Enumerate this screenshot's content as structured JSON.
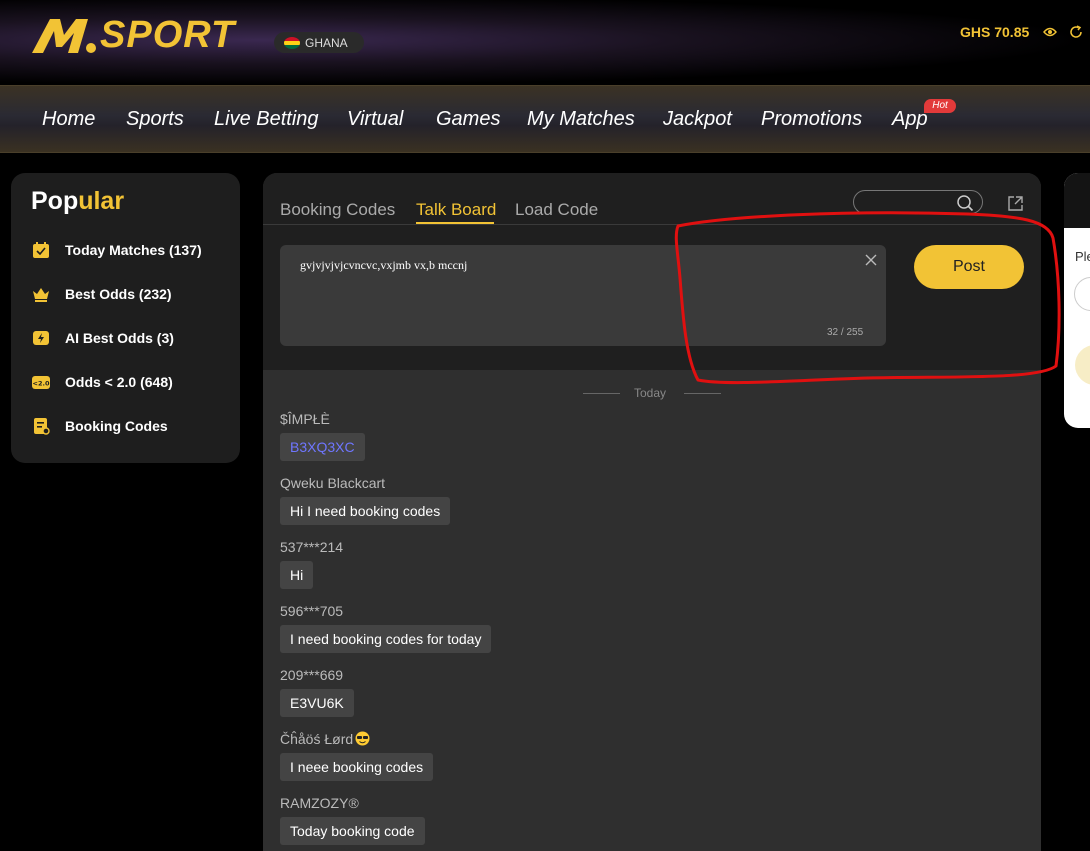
{
  "header": {
    "logo_text": "SPORT",
    "country": "GHANA",
    "balance": "GHS 70.85",
    "icons": [
      "m-logo-icon",
      "ghana-flag-icon",
      "eye-icon",
      "refresh-icon"
    ]
  },
  "nav": {
    "items": [
      "Home",
      "Sports",
      "Live Betting",
      "Virtual",
      "Games",
      "My Matches",
      "Jackpot",
      "Promotions",
      "App"
    ],
    "hot_badge": "Hot"
  },
  "sidebar": {
    "title_white": "Pop",
    "title_yellow": "ular",
    "items": [
      {
        "label": "Today Matches (137)",
        "icon": "calendar-icon"
      },
      {
        "label": "Best Odds (232)",
        "icon": "crown-icon"
      },
      {
        "label": "AI Best Odds (3)",
        "icon": "lightning-icon"
      },
      {
        "label": "Odds < 2.0 (648)",
        "icon": "odds-icon"
      },
      {
        "label": "Booking Codes",
        "icon": "booking-icon"
      }
    ]
  },
  "main": {
    "tabs": [
      "Booking Codes",
      "Talk Board",
      "Load Code"
    ],
    "active_tab": "Talk Board",
    "search_value": "",
    "composer_text": "gvjvjvjvjcvncvc,vxjmb vx,b mccnj",
    "char_count": "32 / 255",
    "post_label": "Post",
    "date_separator": "Today",
    "messages": [
      {
        "user": "$ÎMPŁÈ",
        "text": "B3XQ3XC",
        "is_code": true
      },
      {
        "user": "Qweku Blackcart",
        "text": "Hi I need booking codes",
        "is_code": false
      },
      {
        "user": "537***214",
        "text": "Hi",
        "is_code": false
      },
      {
        "user": "596***705",
        "text": "I need booking codes for today",
        "is_code": false
      },
      {
        "user": "209***669",
        "text": "E3VU6K",
        "is_code": false
      },
      {
        "user": "Čĥåöś Łørd",
        "text": "I neee booking codes",
        "is_code": false
      },
      {
        "user": "RAMZOZY®",
        "text": "Today booking code",
        "is_code": false
      }
    ]
  },
  "right_panel": {
    "label": "Ple"
  },
  "colors": {
    "accent": "#f2c335",
    "annotation": "#e01010",
    "code_link": "#6f76ff"
  }
}
